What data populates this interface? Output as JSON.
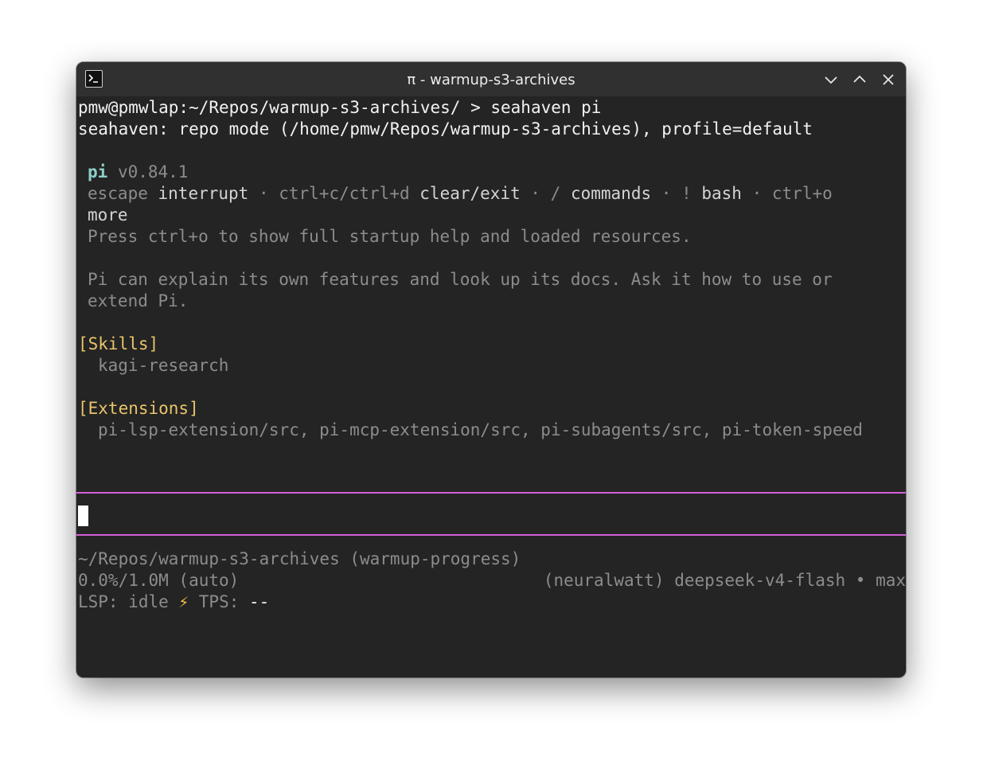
{
  "window": {
    "title": "π - warmup-s3-archives",
    "icons": {
      "app": "terminal-icon",
      "minimize": "chevron-down-icon",
      "maximize": "chevron-up-icon",
      "close": "close-icon"
    }
  },
  "terminal": {
    "prompt": "pmw@pmwlap:~/Repos/warmup-s3-archives/ > seahaven pi",
    "mode_line": "seahaven: repo mode (/home/pmw/Repos/warmup-s3-archives), profile=default",
    "app_name": "pi",
    "version": "v0.84.1",
    "keys": {
      "escape": "escape",
      "interrupt": "interrupt",
      "sep1": " · ",
      "ctrl_c": "ctrl+c/ctrl+d",
      "clear_exit": "clear/exit",
      "sep2": " · ",
      "slash": "/",
      "commands": "commands",
      "sep3": " · ",
      "bang": "!",
      "bash": "bash",
      "sep4": " · ",
      "ctrl_o": "ctrl+o",
      "more": "more"
    },
    "startup_help": "Press ctrl+o to show full startup help and loaded resources.",
    "explain_1": "Pi can explain its own features and look up its docs. Ask it how to use or",
    "explain_2": "extend Pi.",
    "skills_header": "[Skills]",
    "skills": [
      "kagi-research"
    ],
    "extensions_header": "[Extensions]",
    "extensions": "pi-lsp-extension/src, pi-mcp-extension/src, pi-subagents/src, pi-token-speed"
  },
  "status": {
    "path": "~/Repos/warmup-s3-archives (warmup-progress)",
    "context": "0.0%/1.0M (auto)",
    "model": "(neuralwatt) deepseek-v4-flash • max",
    "lsp_label": "LSP:",
    "lsp_state": "idle",
    "bolt": "⚡",
    "tps_label": "TPS:",
    "tps_value": "--"
  },
  "colors": {
    "terminal_bg": "#242424",
    "titlebar_bg": "#303030",
    "separator": "#d45fd8",
    "heading_yellow": "#e9c46a",
    "app_teal": "#8dd0c8"
  }
}
